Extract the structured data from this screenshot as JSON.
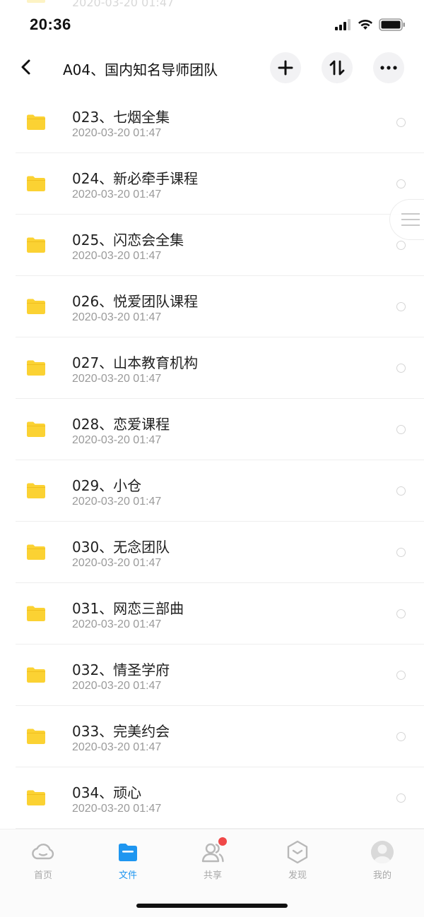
{
  "status_bar": {
    "time": "20:36"
  },
  "ghost_row": {
    "date": "2020-03-20 01:47"
  },
  "nav": {
    "title": "A04、国内知名导师团队",
    "back_icon": "chevron-left-icon",
    "add_icon": "plus-icon",
    "sort_icon": "sort-icon",
    "more_icon": "more-dots-icon"
  },
  "files": [
    {
      "name": "023、七烟全集",
      "date": "2020-03-20 01:47"
    },
    {
      "name": "024、新必牵手课程",
      "date": "2020-03-20 01:47"
    },
    {
      "name": "025、闪恋会全集",
      "date": "2020-03-20 01:47"
    },
    {
      "name": "026、悦爱团队课程",
      "date": "2020-03-20 01:47"
    },
    {
      "name": "027、山本教育机构",
      "date": "2020-03-20 01:47"
    },
    {
      "name": "028、恋爱课程",
      "date": "2020-03-20 01:47"
    },
    {
      "name": "029、小仓",
      "date": "2020-03-20 01:47"
    },
    {
      "name": "030、无念团队",
      "date": "2020-03-20 01:47"
    },
    {
      "name": "031、网恋三部曲",
      "date": "2020-03-20 01:47"
    },
    {
      "name": "032、情圣学府",
      "date": "2020-03-20 01:47"
    },
    {
      "name": "033、完美约会",
      "date": "2020-03-20 01:47"
    },
    {
      "name": "034、顽心",
      "date": "2020-03-20 01:47"
    }
  ],
  "tabs": [
    {
      "label": "首页",
      "icon": "cloud-home-icon",
      "active": false
    },
    {
      "label": "文件",
      "icon": "folder-icon",
      "active": true
    },
    {
      "label": "共享",
      "icon": "users-icon",
      "active": false
    },
    {
      "label": "发现",
      "icon": "discover-box-icon",
      "active": false
    },
    {
      "label": "我的",
      "icon": "avatar-icon",
      "active": false
    }
  ],
  "colors": {
    "accent": "#1e96f0",
    "folder": "#fbd233",
    "badge": "#f04848"
  }
}
